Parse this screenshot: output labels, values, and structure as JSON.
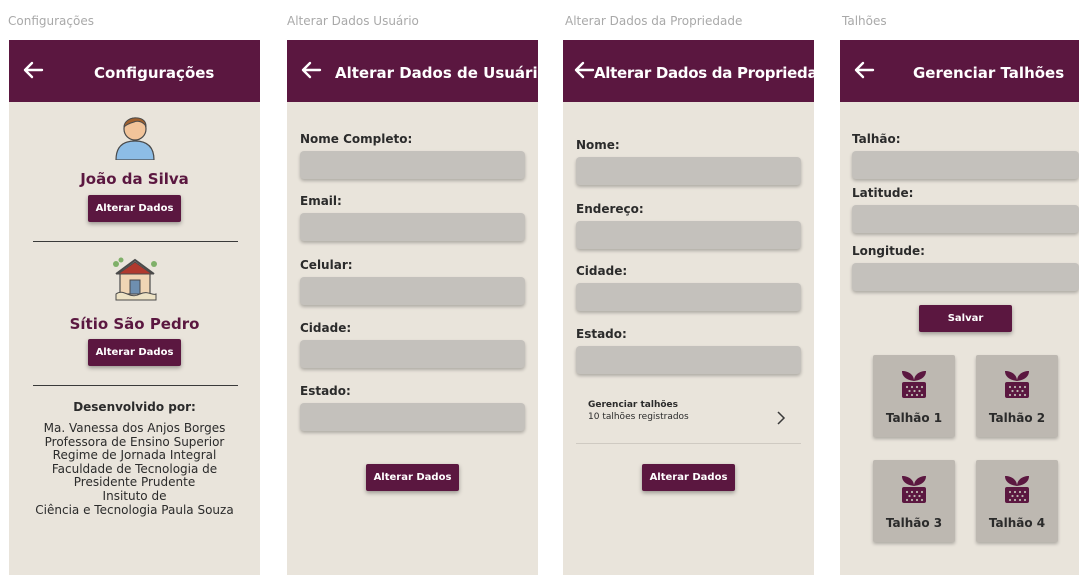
{
  "captions": {
    "config": "Configurações",
    "user": "Alterar Dados Usuário",
    "property": "Alterar Dados da Propriedade",
    "plots": "Talhões"
  },
  "config_screen": {
    "title": "Configurações",
    "user_name": "João da Silva",
    "user_button": "Alterar Dados",
    "property_name": "Sítio São Pedro",
    "property_button": "Alterar Dados",
    "credits_heading": "Desenvolvido por:",
    "credits_lines": [
      "Ma. Vanessa dos Anjos Borges",
      "Professora de Ensino Superior",
      "Regime de Jornada Integral",
      "Faculdade de Tecnologia de",
      "Presidente Prudente",
      "Insituto de",
      "Ciência e Tecnologia Paula Souza"
    ]
  },
  "user_screen": {
    "title": "Alterar Dados de Usuário",
    "labels": [
      "Nome Completo:",
      "Email:",
      "Celular:",
      "Cidade:",
      "Estado:"
    ],
    "button": "Alterar Dados"
  },
  "property_screen": {
    "title": "Alterar Dados da Propriedade",
    "labels": [
      "Nome:",
      "Endereço:",
      "Cidade:",
      "Estado:"
    ],
    "manage_title": "Gerenciar talhões",
    "manage_subtitle": "10 talhões registrados",
    "button": "Alterar Dados"
  },
  "plots_screen": {
    "title": "Gerenciar Talhões",
    "labels": [
      "Talhão:",
      "Latitude:",
      "Longitude:"
    ],
    "save_button": "Salvar",
    "plots": [
      "Talhão 1",
      "Talhão 2",
      "Talhão 3",
      "Talhão 4"
    ]
  },
  "colors": {
    "primary": "#5b1740",
    "background": "#e9e4db",
    "field": "#c4c1bc",
    "tile": "#bdb8b1"
  }
}
